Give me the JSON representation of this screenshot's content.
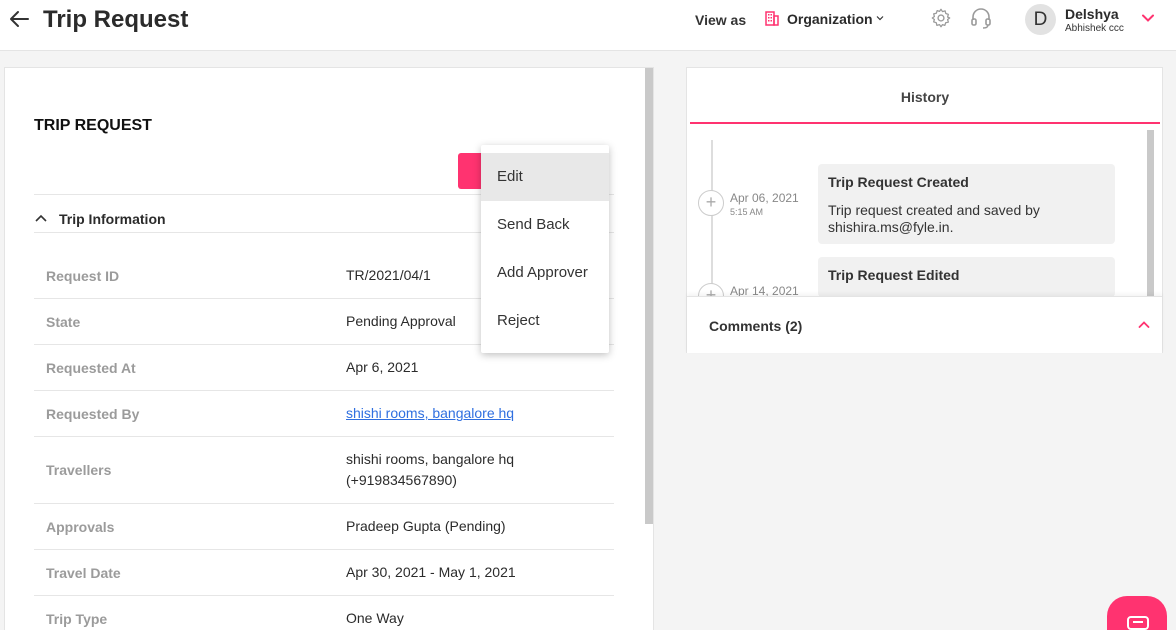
{
  "header": {
    "title": "Trip Request",
    "view_as_label": "View as",
    "organization_label": "Organization",
    "avatar_letter": "D",
    "user_name": "Delshya",
    "user_org": "Abhishek ccc"
  },
  "trip": {
    "section_title": "TRIP REQUEST",
    "info_header": "Trip Information",
    "rows": [
      {
        "label": "Request ID",
        "value": "TR/2021/04/1"
      },
      {
        "label": "State",
        "value": "Pending Approval"
      },
      {
        "label": "Requested At",
        "value": "Apr 6, 2021"
      },
      {
        "label": "Requested By",
        "value": "shishi rooms, bangalore hq"
      },
      {
        "label": "Travellers",
        "value": "shishi rooms, bangalore hq (+919834567890)"
      },
      {
        "label": "Approvals",
        "value": "Pradeep Gupta (Pending)"
      },
      {
        "label": "Travel Date",
        "value": "Apr 30, 2021 - May 1, 2021"
      },
      {
        "label": "Trip Type",
        "value": "One Way"
      }
    ]
  },
  "dropdown": {
    "items": [
      "Edit",
      "Send Back",
      "Add Approver",
      "Reject"
    ]
  },
  "history": {
    "tab_label": "History",
    "events": [
      {
        "date": "Apr 06, 2021",
        "time": "5:15 AM",
        "title": "Trip Request Created",
        "body": "Trip request created and saved by shishira.ms@fyle.in."
      },
      {
        "date": "Apr 14, 2021",
        "title": "Trip Request Edited"
      }
    ]
  },
  "comments": {
    "label": "Comments (2)"
  },
  "colors": {
    "accent": "#ff3370"
  }
}
